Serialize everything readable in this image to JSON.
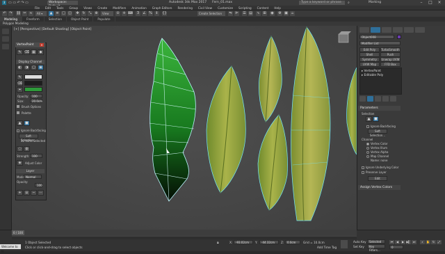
{
  "window": {
    "title": "Autodesk 3ds Max 2017",
    "file": "Fern_01.max",
    "workspace": "Workspace: Default",
    "search_placeholder": "Type a keyword or phrase",
    "user": "Marking"
  },
  "menu": [
    "File",
    "Edit",
    "Tools",
    "Group",
    "Views",
    "Create",
    "Modifiers",
    "Animation",
    "Graph Editors",
    "Rendering",
    "Civil View",
    "Customize",
    "Scripting",
    "Content",
    "Help"
  ],
  "toolbar": {
    "selection_set": "Create Selection Set",
    "view_label": "View"
  },
  "ribbon": {
    "tabs": [
      "Modeling",
      "Freeform",
      "Selection",
      "Object Paint",
      "Populate"
    ],
    "active": "Modeling",
    "sub": "Polygon Modeling"
  },
  "viewport": {
    "label": "[+] [Perspective] [Default Shading] [Object Paint]"
  },
  "vertexpaint": {
    "title": "VertexPaint",
    "display_channel": "Display Channel",
    "opacity_label": "Opacity:",
    "opacity_value": "100",
    "size_label": "Size:",
    "size_value": "20.0cm",
    "brush_options": "Brush Options",
    "palette": "Palette",
    "ignore_backfacing": "Ignore Backfacing",
    "soft_selection": "Soft Selection...",
    "verts_selected": "32 Verts Selected",
    "strength_label": "Strength:",
    "strength_value": "100",
    "adjust_color": "Adjust Color",
    "layer": "Layer",
    "mode_label": "Mode:",
    "mode_value": "Normal",
    "layer_opacity": "Opacity:",
    "layer_opacity_value": "100",
    "paint_color": "#2e9a3a",
    "paint_color2": "#1d1d1d"
  },
  "cmdpanel": {
    "object_name": "Object008",
    "modifier_list": "Modifier List",
    "buttons": [
      "Edit Poly",
      "TurboSmooth",
      "Shell",
      "Push",
      "Symmetry",
      "Unwrap UVW",
      "UVW Map",
      "FFD Box"
    ],
    "stack": [
      "VertexPaint",
      "Editable Poly"
    ],
    "parameters_title": "Parameters",
    "selection_label": "Selection",
    "ignore_backfacing": "Ignore Backfacing",
    "soft_selection": "Soft Selection...",
    "channel_label": "Channel",
    "channels": [
      "Vertex Color",
      "Vertex Illum",
      "Vertex Alpha",
      "Map Channel"
    ],
    "active_channel": "Vertex Color",
    "map_name": "Name: none",
    "ignore_underlying": "Ignore Underlying Color",
    "preserve_layer": "Preserve Layer",
    "edit_button": "Edit",
    "assign_rollout": "Assign Vertex Colors"
  },
  "status": {
    "objects_selected": "1 Object Selected",
    "prompt": "Click or click-and-drag to select objects",
    "welcome": "Welcome to M",
    "x_label": "X:",
    "x_value": "-93.02cm",
    "y_label": "Y:",
    "y_value": "-44.32cm",
    "z_label": "Z:",
    "z_value": "0.0cm",
    "grid": "Grid = 10.0cm",
    "add_time_tag": "Add Time Tag",
    "auto_key": "Auto Key",
    "selected": "Selected",
    "set_key": "Set Key",
    "key_filters": "Key Filters...",
    "frame": "0",
    "timeline_range": "0 / 100"
  }
}
